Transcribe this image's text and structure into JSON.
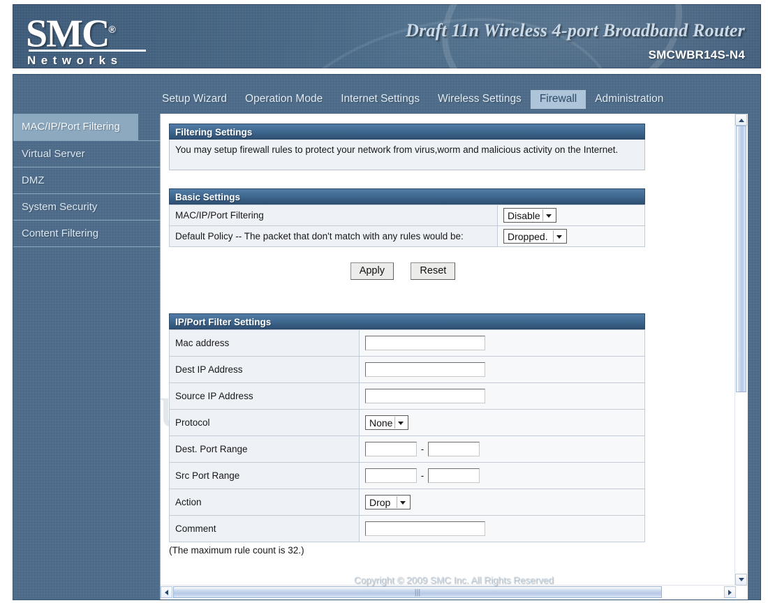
{
  "banner": {
    "logo_main": "SMC",
    "logo_reg": "®",
    "logo_sub": "Networks",
    "product_title": "Draft 11n Wireless 4-port Broadband Router",
    "model": "SMCWBR14S-N4"
  },
  "nav": {
    "items": [
      {
        "label": "Setup Wizard",
        "active": false
      },
      {
        "label": "Operation Mode",
        "active": false
      },
      {
        "label": "Internet Settings",
        "active": false
      },
      {
        "label": "Wireless Settings",
        "active": false
      },
      {
        "label": "Firewall",
        "active": true
      },
      {
        "label": "Administration",
        "active": false
      }
    ]
  },
  "sidebar": {
    "items": [
      {
        "label": "MAC/IP/Port Filtering",
        "active": true
      },
      {
        "label": "Virtual Server",
        "active": false
      },
      {
        "label": "DMZ",
        "active": false
      },
      {
        "label": "System Security",
        "active": false
      },
      {
        "label": "Content Filtering",
        "active": false
      }
    ]
  },
  "filtering_settings": {
    "header": "Filtering Settings",
    "description": "You may setup firewall rules to protect your network from virus,worm and malicious activity on the Internet."
  },
  "basic_settings": {
    "header": "Basic Settings",
    "rows": [
      {
        "label": "MAC/IP/Port Filtering",
        "value": "Disable",
        "control": "select"
      },
      {
        "label": "Default Policy -- The packet that don't match with any rules would be:",
        "value": "Dropped.",
        "control": "select"
      }
    ],
    "apply_label": "Apply",
    "reset_label": "Reset"
  },
  "ip_port_filter_settings": {
    "header": "IP/Port Filter Settings",
    "rows": [
      {
        "label": "Mac address",
        "control": "text",
        "value": ""
      },
      {
        "label": "Dest IP Address",
        "control": "text",
        "value": ""
      },
      {
        "label": "Source IP Address",
        "control": "text",
        "value": ""
      },
      {
        "label": "Protocol",
        "control": "select",
        "value": "None"
      },
      {
        "label": "Dest. Port Range",
        "control": "range",
        "value": "",
        "value2": "",
        "separator": "-"
      },
      {
        "label": "Src Port Range",
        "control": "range",
        "value": "",
        "value2": "",
        "separator": "-"
      },
      {
        "label": "Action",
        "control": "select",
        "value": "Drop"
      },
      {
        "label": "Comment",
        "control": "text",
        "value": ""
      }
    ],
    "note": "(The maximum rule count is 32.)"
  },
  "watermark": "SetupRouter.com",
  "footer": {
    "copyright": "Copyright © 2009 SMC Inc. All Rights Reserved"
  },
  "scrollbars": {
    "vertical_up_icon": "chevron-up-icon",
    "vertical_down_icon": "chevron-down-icon",
    "horizontal_left_icon": "chevron-left-icon",
    "horizontal_right_icon": "chevron-right-icon"
  },
  "colors": {
    "banner_blue": "#44627f",
    "frame_blue": "#4d6b88",
    "section_header": "#416a92",
    "row_label_bg": "#eef1f5",
    "nav_active_bg": "#aec4d8"
  }
}
